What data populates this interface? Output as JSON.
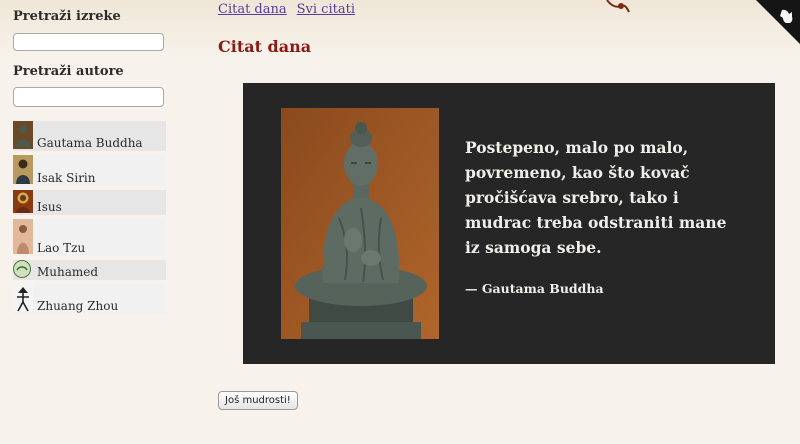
{
  "sidebar": {
    "search_quotes_label": "Pretraži izreke",
    "search_quotes_value": "",
    "search_authors_label": "Pretraži autore",
    "search_authors_value": "",
    "authors": [
      {
        "name": "Gautama Buddha",
        "icon": "buddha-portrait"
      },
      {
        "name": "Isak Sirin",
        "icon": "isaac-portrait"
      },
      {
        "name": "Isus",
        "icon": "jesus-icon-portrait"
      },
      {
        "name": "Lao Tzu",
        "icon": "lao-tzu-portrait"
      },
      {
        "name": "Muhamed",
        "icon": "calligraphy-seal"
      },
      {
        "name": "Zhuang Zhou",
        "icon": "zhuang-zhou-figure"
      }
    ]
  },
  "nav": {
    "links": [
      "Citat dana",
      "Svi citati"
    ]
  },
  "main": {
    "title": "Citat dana",
    "quote": {
      "text": "Postepeno, malo po malo, povremeno, kao što kovač pročišćava srebro, tako i mudrac treba odstraniti mane iz samoga sebe.",
      "author": "— Gautama Buddha",
      "image": "buddha-statue"
    },
    "more_button": "Još mudrosti!"
  },
  "colors": {
    "title": "#8b1a14",
    "link": "#5b3b9a",
    "card_bg": "#262626",
    "quote_text": "#f0eee9",
    "page_bg": "#f7f3ec"
  }
}
